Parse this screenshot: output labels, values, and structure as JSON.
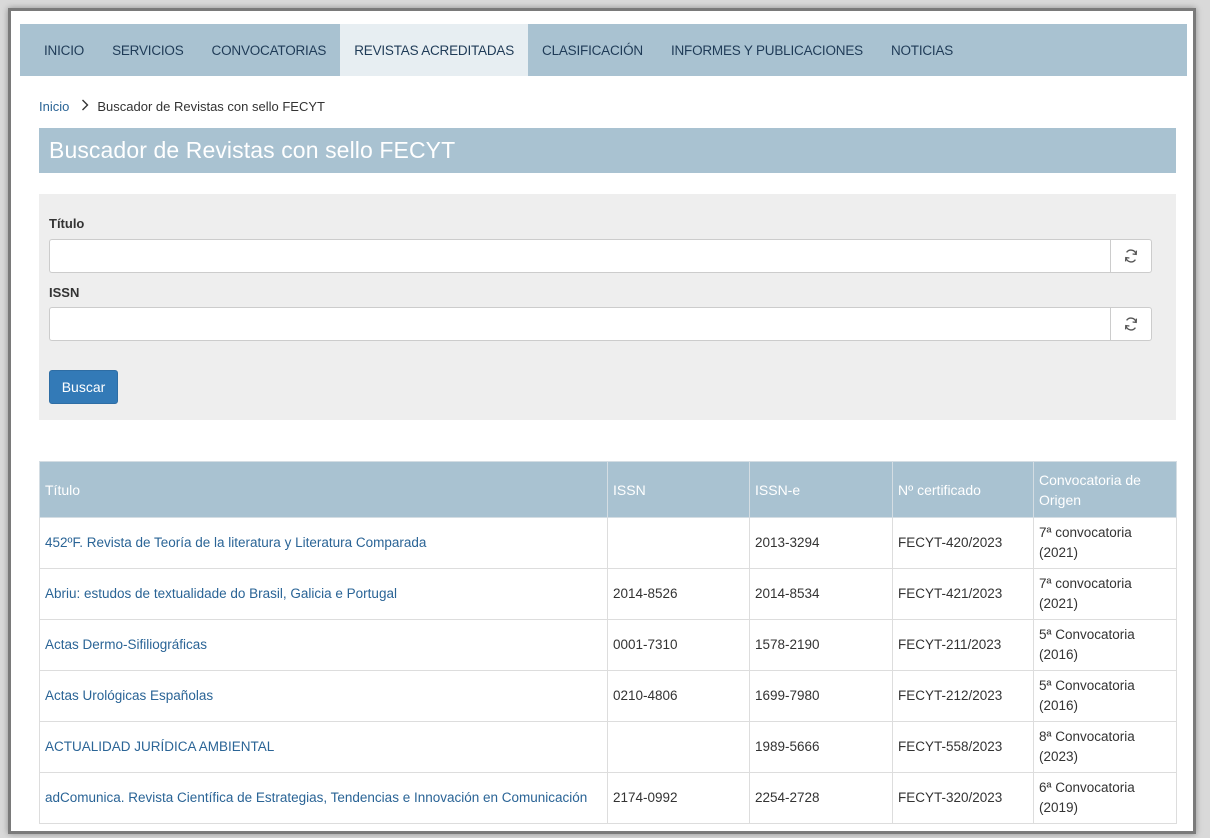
{
  "nav": {
    "items": [
      {
        "label": "INICIO",
        "active": false
      },
      {
        "label": "SERVICIOS",
        "active": false
      },
      {
        "label": "CONVOCATORIAS",
        "active": false
      },
      {
        "label": "REVISTAS ACREDITADAS",
        "active": true
      },
      {
        "label": "CLASIFICACIÓN",
        "active": false
      },
      {
        "label": "INFORMES Y PUBLICACIONES",
        "active": false
      },
      {
        "label": "NOTICIAS",
        "active": false
      }
    ]
  },
  "breadcrumb": {
    "home": "Inicio",
    "current": "Buscador de Revistas con sello FECYT"
  },
  "page_title": "Buscador de Revistas con sello FECYT",
  "search": {
    "titulo_label": "Título",
    "titulo_value": "",
    "issn_label": "ISSN",
    "issn_value": "",
    "button_label": "Buscar"
  },
  "table": {
    "headers": [
      "Título",
      "ISSN",
      "ISSN-e",
      "Nº certificado",
      "Convocatoria de Origen"
    ],
    "rows": [
      {
        "titulo": "452ºF. Revista de Teoría de la literatura y Literatura Comparada",
        "issn": "",
        "issn_e": "2013-3294",
        "certificado": "FECYT-420/2023",
        "convocatoria": "7ª convocatoria (2021)"
      },
      {
        "titulo": "Abriu: estudos de textualidade do Brasil, Galicia e Portugal",
        "issn": "2014-8526",
        "issn_e": "2014-8534",
        "certificado": "FECYT-421/2023",
        "convocatoria": "7ª convocatoria (2021)"
      },
      {
        "titulo": "Actas Dermo-Sifiliográficas",
        "issn": "0001-7310",
        "issn_e": "1578-2190",
        "certificado": "FECYT-211/2023",
        "convocatoria": "5ª Convocatoria (2016)"
      },
      {
        "titulo": "Actas Urológicas Españolas",
        "issn": "0210-4806",
        "issn_e": "1699-7980",
        "certificado": "FECYT-212/2023",
        "convocatoria": "5ª Convocatoria (2016)"
      },
      {
        "titulo": "ACTUALIDAD JURÍDICA AMBIENTAL",
        "issn": "",
        "issn_e": "1989-5666",
        "certificado": "FECYT-558/2023",
        "convocatoria": "8ª Convocatoria (2023)"
      },
      {
        "titulo": "adComunica. Revista Científica de Estrategias, Tendencias e Innovación en Comunicación",
        "issn": "2174-0992",
        "issn_e": "2254-2728",
        "certificado": "FECYT-320/2023",
        "convocatoria": "6ª Convocatoria (2019)"
      }
    ]
  },
  "colors": {
    "accent": "#a9c2d1",
    "active_tab": "#e7eef2",
    "button": "#337ab7",
    "link": "#2a6496"
  },
  "icons": {
    "reset": "refresh-icon",
    "breadcrumb_separator": "chevron-right-icon"
  }
}
